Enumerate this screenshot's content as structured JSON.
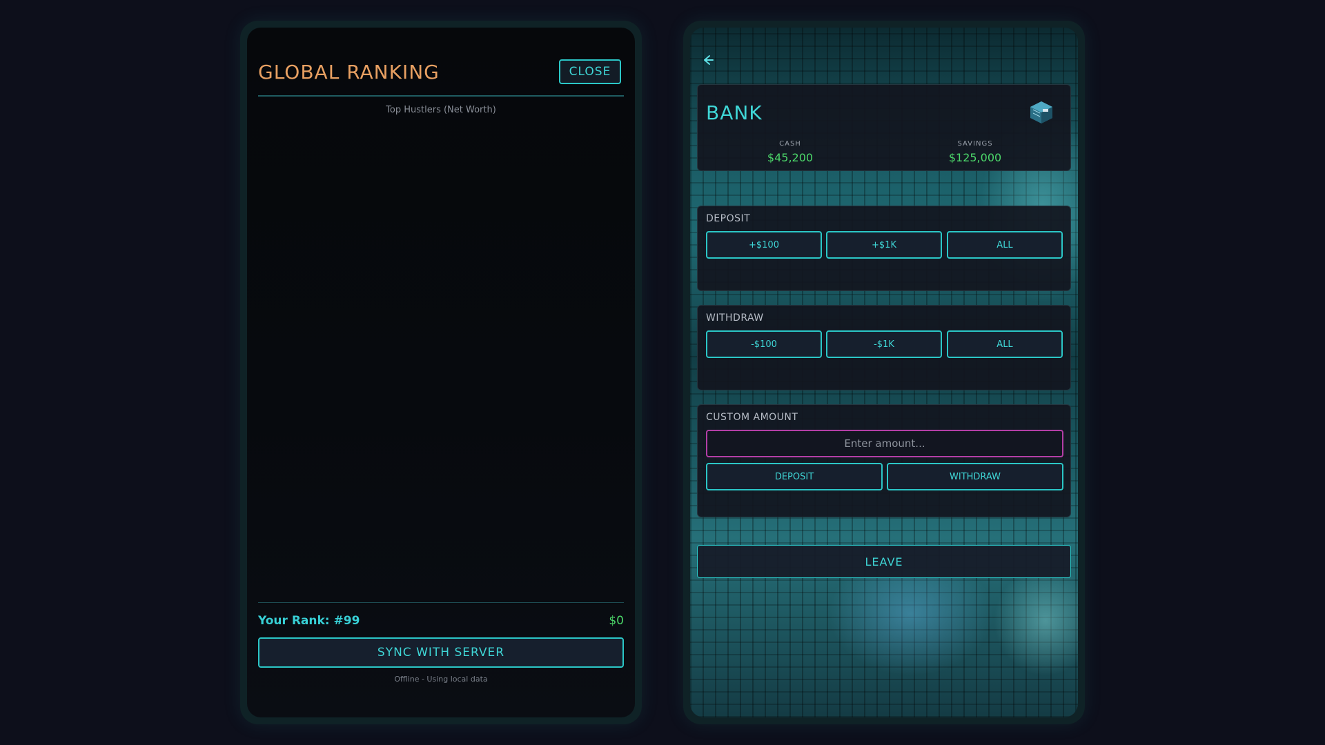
{
  "ranking": {
    "title": "GLOBAL RANKING",
    "close_label": "CLOSE",
    "subtitle": "Top Hustlers (Net Worth)",
    "your_rank": "Your Rank: #99",
    "your_worth": "$0",
    "sync_label": "SYNC WITH SERVER",
    "status": "Offline - Using local data"
  },
  "bank": {
    "back_icon": "arrow-left-icon",
    "title": "BANK",
    "icon": "safe-icon",
    "cash_label": "CASH",
    "cash_value": "$45,200",
    "savings_label": "SAVINGS",
    "savings_value": "$125,000",
    "deposit": {
      "label": "DEPOSIT",
      "buttons": [
        "+$100",
        "+$1K",
        "ALL"
      ]
    },
    "withdraw": {
      "label": "WITHDRAW",
      "buttons": [
        "-$100",
        "-$1K",
        "ALL"
      ]
    },
    "custom": {
      "label": "CUSTOM AMOUNT",
      "placeholder": "Enter amount...",
      "deposit_label": "DEPOSIT",
      "withdraw_label": "WITHDRAW"
    },
    "leave_label": "LEAVE"
  },
  "colors": {
    "accent_cyan": "#3fd6d6",
    "title_orange": "#e8a062",
    "money_green": "#4cd86a",
    "input_magenta": "#b33ea6",
    "background": "#0d0f1b"
  }
}
